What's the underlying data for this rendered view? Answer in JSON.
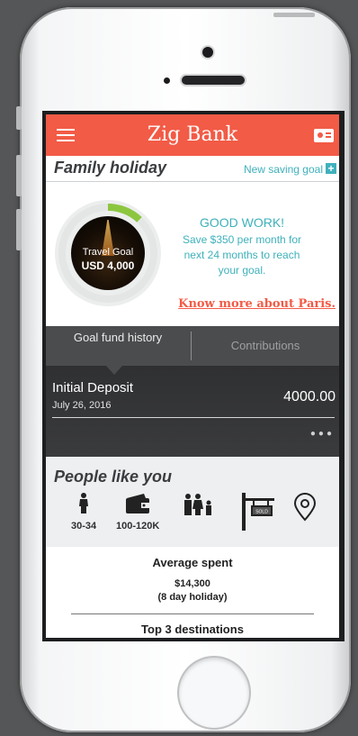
{
  "header": {
    "title": "Zig Bank"
  },
  "goal": {
    "name": "Family holiday",
    "new_goal_label": "New saving goal",
    "circle_label": "Travel Goal",
    "circle_amount": "USD 4,000",
    "progress_fraction": 0.12,
    "headline": "GOOD WORK!",
    "advice": "Save $350 per month for next 24 months to reach your goal.",
    "link": "Know more about Paris."
  },
  "tabs": [
    {
      "label": "Goal fund history"
    },
    {
      "label": "Contributions"
    }
  ],
  "history": [
    {
      "title": "Initial Deposit",
      "date": "July 26, 2016",
      "amount": "4000.00"
    }
  ],
  "people": {
    "title": "People like you",
    "items": [
      {
        "label": "30-34",
        "icon": "person-icon"
      },
      {
        "label": "100-120K",
        "icon": "wallet-icon"
      },
      {
        "label": "",
        "icon": "family-icon"
      },
      {
        "label": "",
        "icon": "sold-sign-icon"
      },
      {
        "label": "",
        "icon": "location-pin-icon"
      }
    ]
  },
  "stats": {
    "average_title": "Average spent",
    "average_value": "$14,300",
    "average_sub": "(8 day holiday)",
    "top_title": "Top 3 destinations"
  },
  "colors": {
    "accent": "#f25b46",
    "teal": "#3fb1bb",
    "progress": "#8cc63f"
  }
}
